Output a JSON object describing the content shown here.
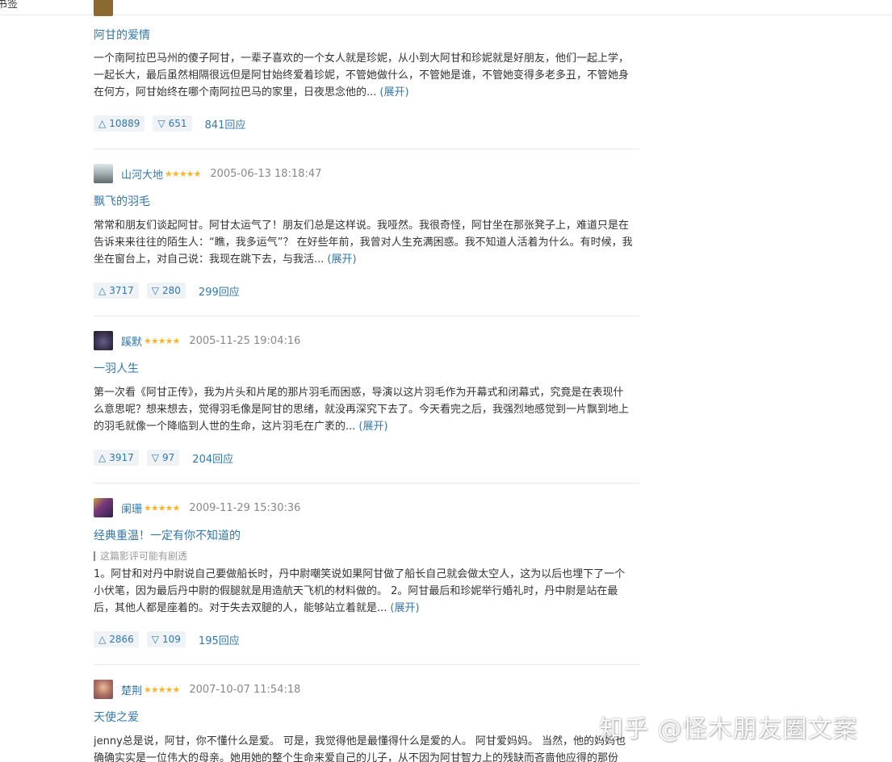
{
  "topbar": {
    "text": "书签"
  },
  "reviews": [
    {
      "title": "阿甘的爱情",
      "body": "一个南阿拉巴马州的傻子阿甘，一辈子喜欢的一个女人就是珍妮，从小到大阿甘和珍妮就是好朋友，他们一起上学，一起长大，最后虽然相隔很远但是阿甘始终爱着珍妮，不管她做什么，不管她是谁，不管她变得多老多丑，不管她身在何方，阿甘始终在哪个南阿拉巴马的家里，日夜思念他的...",
      "expand": "(展开)",
      "up": "10889",
      "down": "651",
      "replies": "841回应"
    },
    {
      "author": "山河大地",
      "stars": "★★★★★",
      "time": "2005-06-13 18:18:47",
      "title": "飘飞的羽毛",
      "body": "常常和朋友们谈起阿甘。阿甘太运气了！朋友们总是这样说。我哑然。我很奇怪，阿甘坐在那张凳子上，难道只是在告诉来来往往的陌生人：“瞧，我多运气”？ 在好些年前，我曾对人生充满困惑。我不知道人活着为什么。有时候，我坐在窗台上，对自己说：我现在跳下去，与我活...",
      "expand": "(展开)",
      "up": "3717",
      "down": "280",
      "replies": "299回应",
      "avatar_color": "#7a8a8c"
    },
    {
      "author": "蹊默",
      "stars": "★★★★★",
      "time": "2005-11-25 19:04:16",
      "title": "一羽人生",
      "body": "第一次看《阿甘正传》，我为片头和片尾的那片羽毛而困惑，导演以这片羽毛作为开幕式和闭幕式，究竟是在表现什么意思呢？想来想去，觉得羽毛像是阿甘的思绪，就没再深究下去了。今天看完之后，我强烈地感觉到一片飘到地上的羽毛就像一个降临到人世的生命，这片羽毛在广袤的...",
      "expand": "(展开)",
      "up": "3917",
      "down": "97",
      "replies": "204回应",
      "avatar_color": "#3a3450"
    },
    {
      "author": "阑珊",
      "stars": "★★★★★",
      "time": "2009-11-29 15:30:36",
      "title": "经典重温！一定有你不知道的",
      "spoiler": "这篇影评可能有剧透",
      "body": "1。阿甘和对丹中尉说自己要做船长时，丹中尉嘲笑说如果阿甘做了船长自己就会做太空人，这为以后也埋下了一个小伏笔，因为最后丹中尉的假腿就是用造航天飞机的材料做的。 2。阿甘最后和珍妮举行婚礼时，丹中尉是站在最后，其他人都是座着的。对于失去双腿的人，能够站立着就是...",
      "expand": "(展开)",
      "up": "2866",
      "down": "109",
      "replies": "195回应",
      "avatar_color": "#5a3a6a"
    },
    {
      "author": "楚荆",
      "stars": "★★★★★",
      "time": "2007-10-07 11:54:18",
      "title": "天使之爱",
      "body": "jenny总是说，阿甘，你不懂什么是爱。 可是，我觉得他是最懂得什么是爱的人。 阿甘爱妈妈。 当然，他的妈妈也确确实实是一位伟大的母亲。她用她的整个生命来爱自己的儿子，从不因为阿甘智力上的残缺而吝啬他应得的那份爱。",
      "avatar_color": "#b07060"
    }
  ],
  "watermark": "知乎 @怪木朋友圈文案",
  "colors": {
    "link": "#3377aa",
    "star": "#f7b52c",
    "vote_bg": "#f0f3f5"
  }
}
